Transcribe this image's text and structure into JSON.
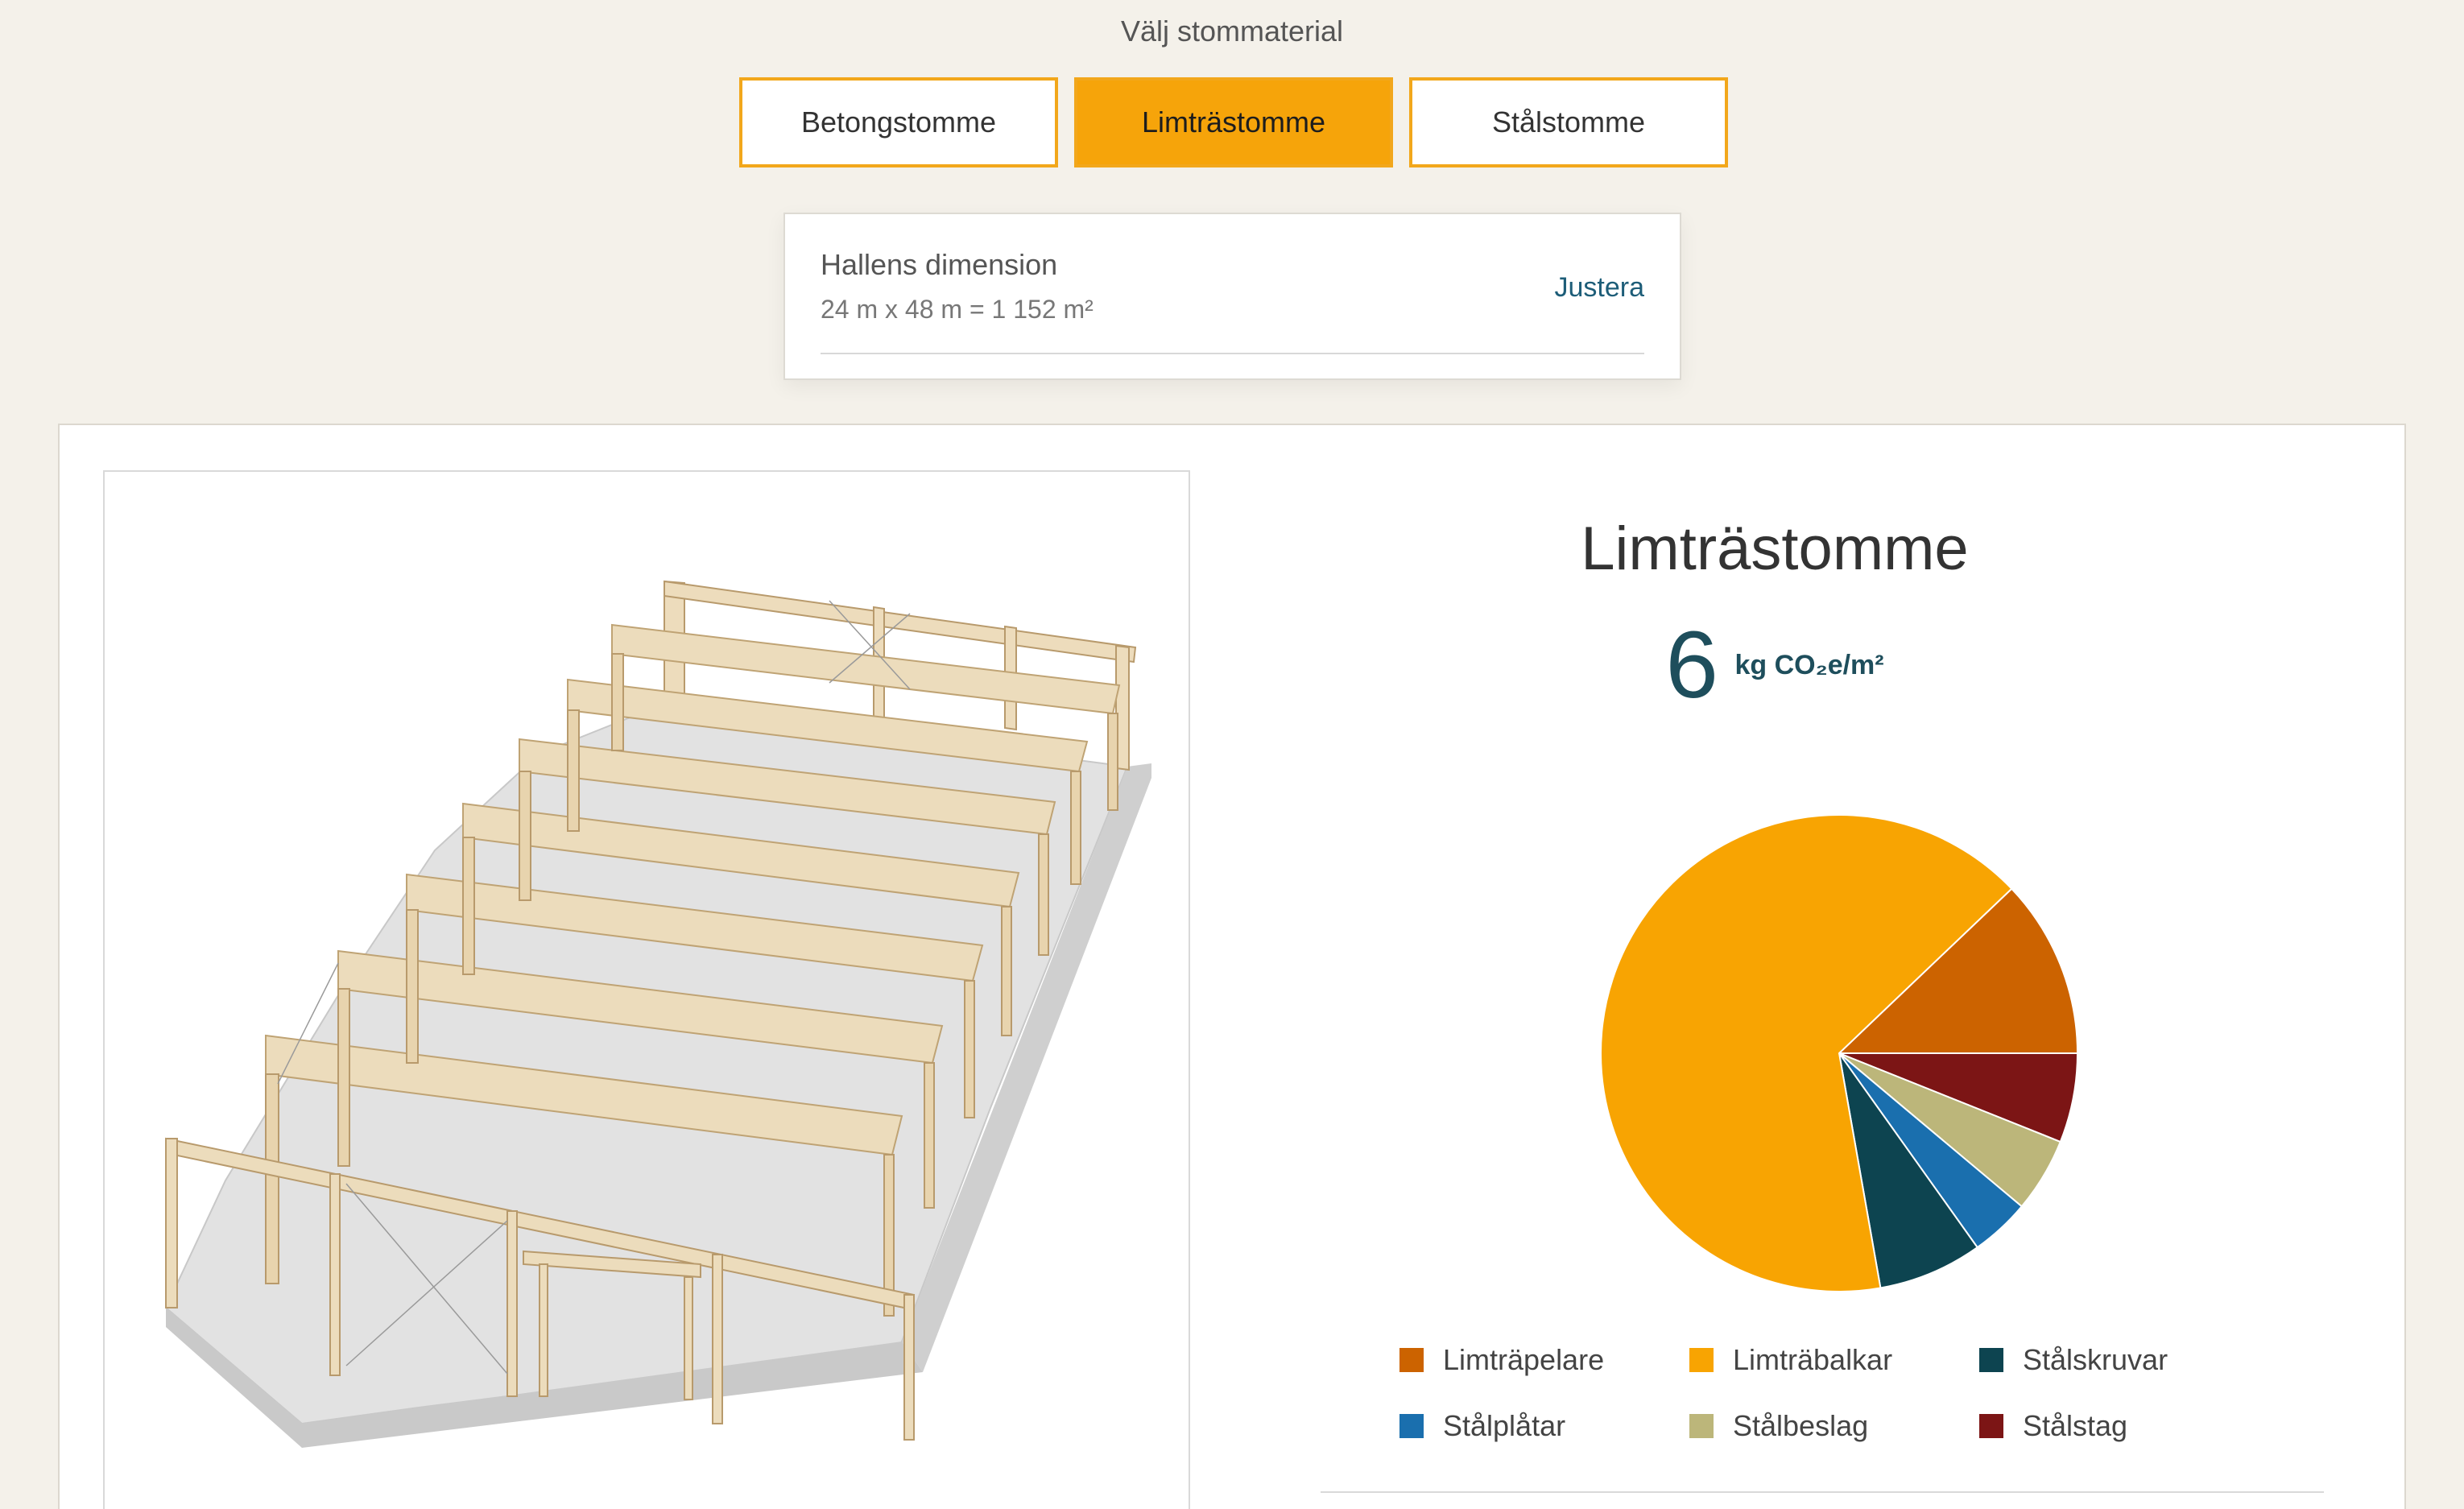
{
  "header": {
    "select_label": "Välj stommaterial",
    "tabs": [
      {
        "label": "Betongstomme",
        "active": false
      },
      {
        "label": "Limträstomme",
        "active": true
      },
      {
        "label": "Stålstomme",
        "active": false
      }
    ]
  },
  "dimension": {
    "title": "Hallens dimension",
    "value": "24 m x 48 m = 1 152 m²",
    "adjust_label": "Justera"
  },
  "result": {
    "title": "Limträstomme",
    "value": "6",
    "unit": "kg CO₂e/m²"
  },
  "colors": {
    "accent": "#f6a40a",
    "tab_border": "#f2a71b",
    "link": "#1d5d78"
  },
  "chart_data": {
    "type": "pie",
    "categories": [
      "Limträpelare",
      "Limträbalkar",
      "Stålskruvar",
      "Stålplåtar",
      "Stålbeslag",
      "Stålstag"
    ],
    "values": [
      12,
      65,
      7,
      4,
      5,
      6
    ],
    "colors": [
      "#cc6300",
      "#f8a402",
      "#0d4450",
      "#1a6fae",
      "#bcb67a",
      "#7c1515"
    ],
    "legend_placement": "bottom",
    "title": "",
    "xlabel": "",
    "ylabel": ""
  }
}
